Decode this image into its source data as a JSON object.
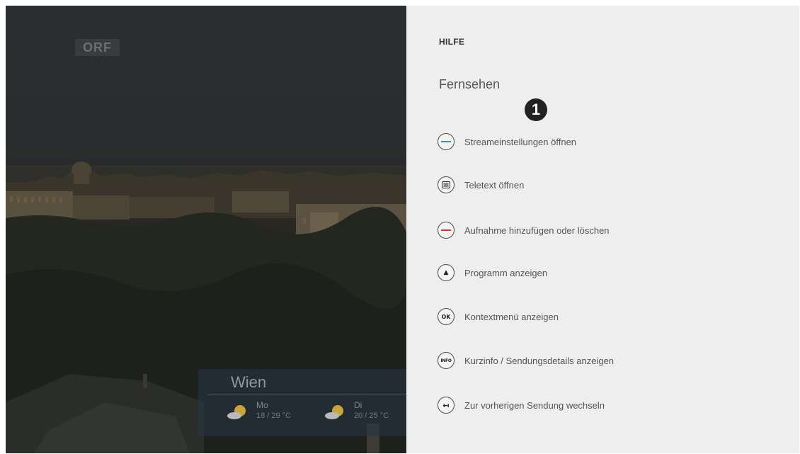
{
  "panel": {
    "title": "HILFE",
    "section": "Fernsehen",
    "marker": "1",
    "items": [
      {
        "label": "Streameinstellungen öffnen",
        "icon": "blue-color-button-icon",
        "color": "#3a8ee6"
      },
      {
        "label": "Teletext öffnen",
        "icon": "teletext-icon"
      },
      {
        "label": "Aufnahme hinzufügen oder löschen",
        "icon": "red-color-button-icon",
        "color": "#d9322e"
      },
      {
        "label": "Programm anzeigen",
        "icon": "up-arrow-icon",
        "symbol": "▲"
      },
      {
        "label": "Kontextmenü anzeigen",
        "icon": "ok-button-icon",
        "symbol": "OK"
      },
      {
        "label": "Kurzinfo / Sendungsdetails anzeigen",
        "icon": "info-button-icon",
        "symbol": "INFO"
      },
      {
        "label": "Zur vorherigen Sendung wechseln",
        "icon": "back-arrow-icon",
        "symbol": "↤"
      }
    ]
  },
  "video": {
    "channel_logo": "ORF",
    "weather": {
      "city": "Wien",
      "days": [
        {
          "day": "Mo",
          "temp": "18 / 29 °C",
          "icon": "partly-sunny-icon"
        },
        {
          "day": "Di",
          "temp": "20 / 25 °C",
          "icon": "partly-sunny-icon"
        }
      ]
    }
  }
}
